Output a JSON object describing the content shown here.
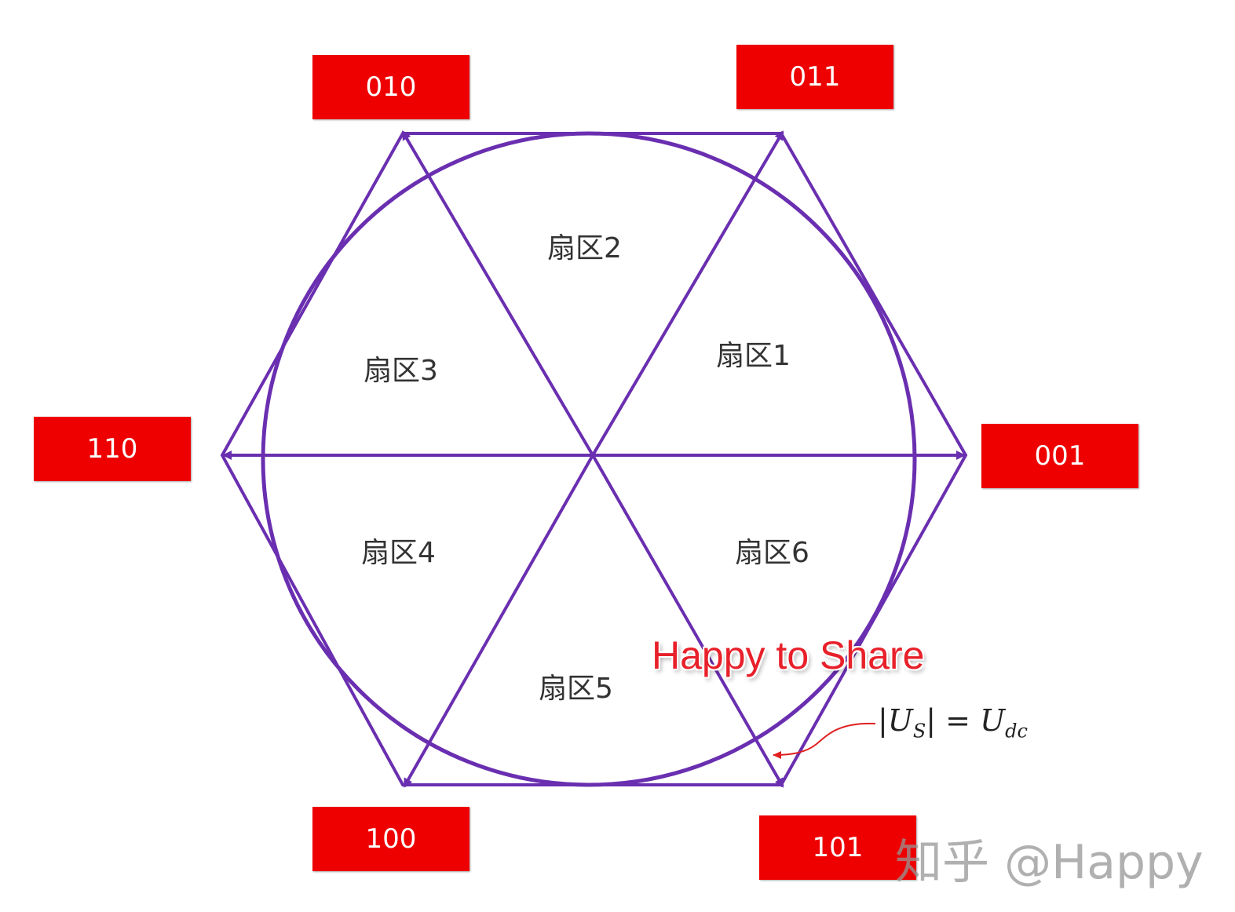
{
  "vector_labels": {
    "v010": "010",
    "v011": "011",
    "v110": "110",
    "v001": "001",
    "v100": "100",
    "v101": "101"
  },
  "sectors": {
    "s1": "扇区1",
    "s2": "扇区2",
    "s3": "扇区3",
    "s4": "扇区4",
    "s5": "扇区5",
    "s6": "扇区6"
  },
  "annotation": {
    "overlay_text": "Happy to Share",
    "formula_lhs": "|U",
    "formula_lhs_sub": "S",
    "formula_rhs": "| = U",
    "formula_rhs_sub": "dc"
  },
  "watermark": "知乎 @Happy",
  "colors": {
    "line": "#6a2fb0",
    "box": "#ee0000",
    "overlay_text": "#e8202a",
    "pointer": "#e02020"
  }
}
